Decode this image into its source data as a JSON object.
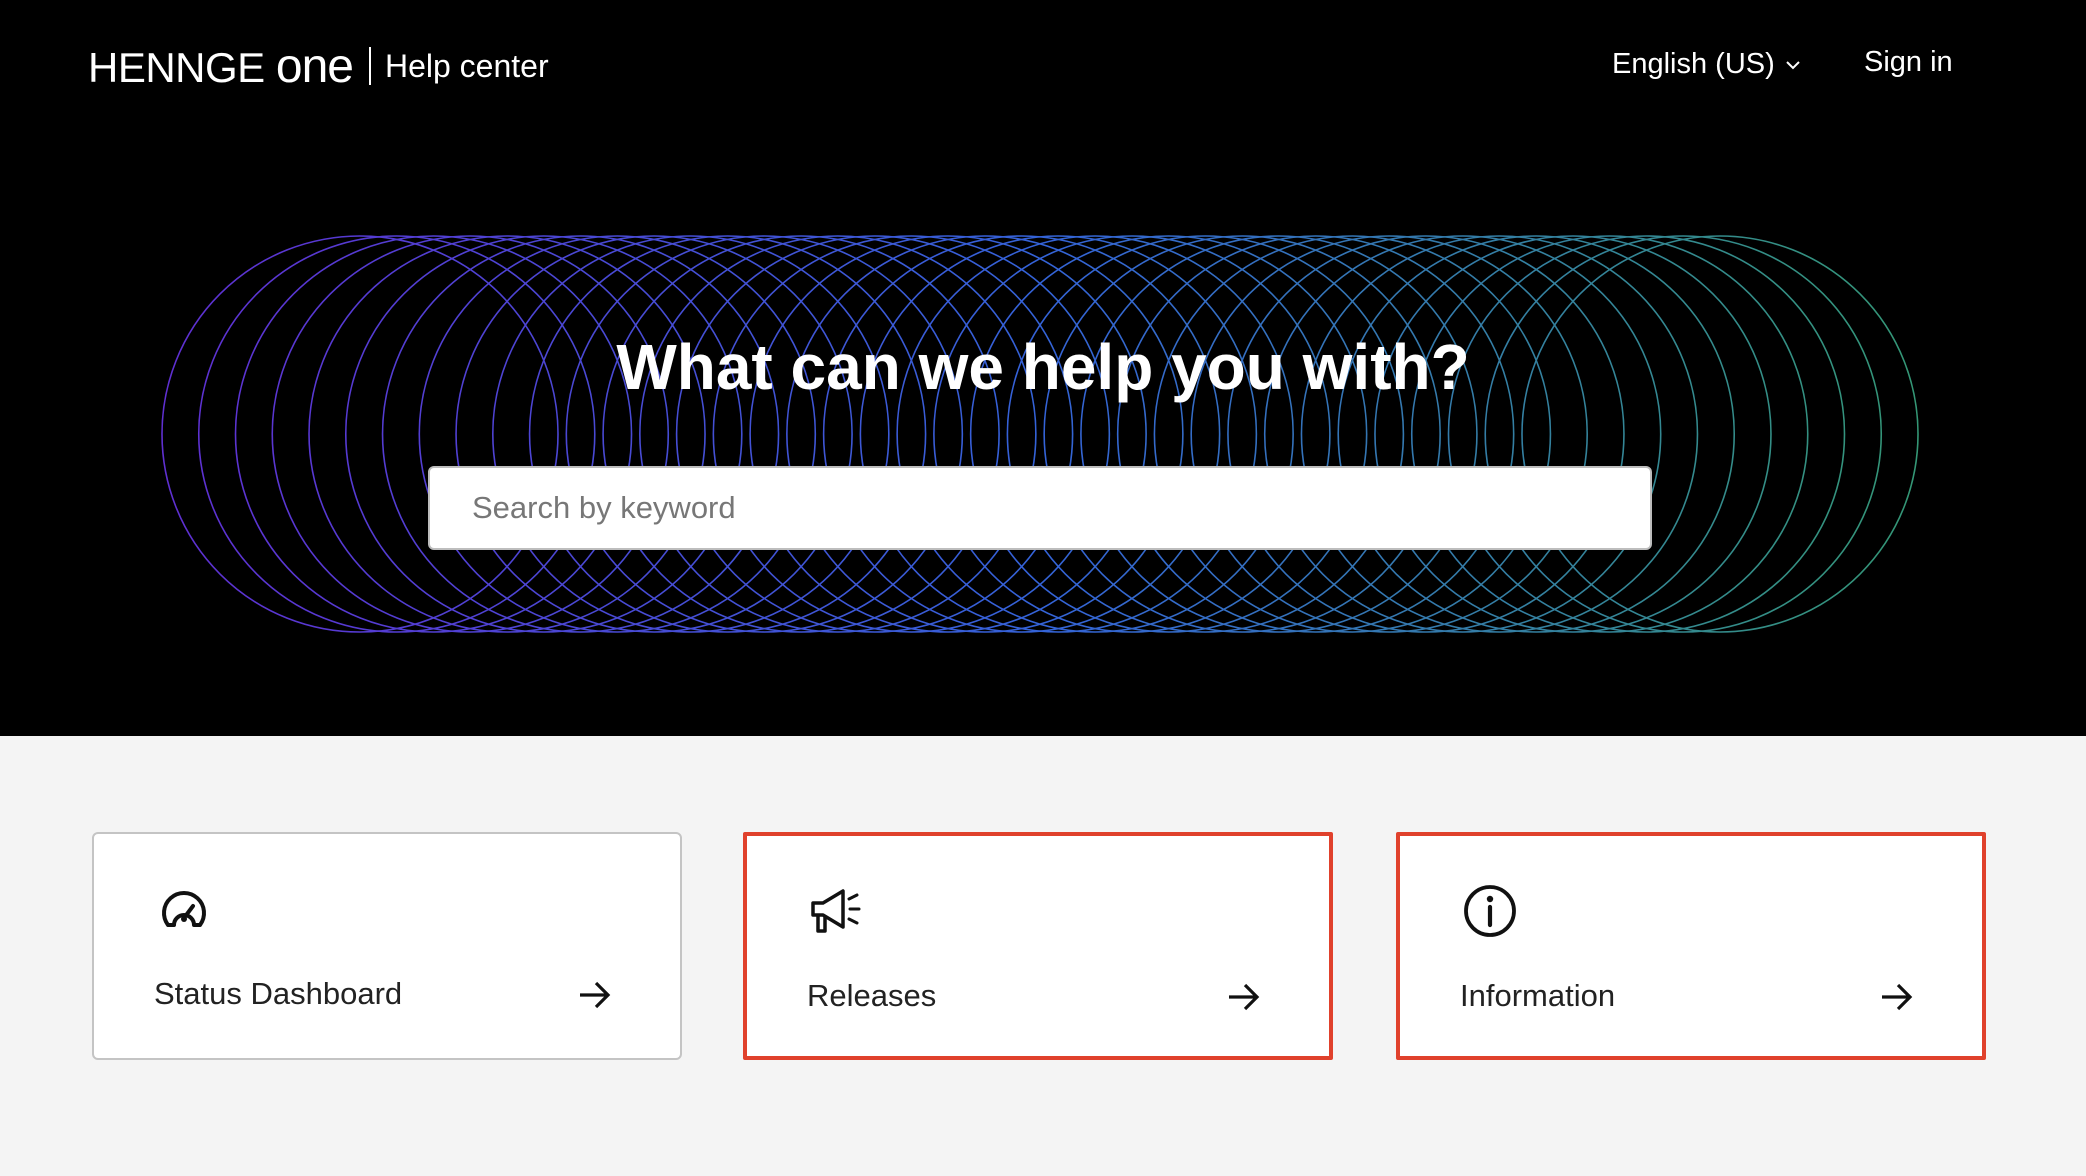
{
  "header": {
    "logo_text": "HENNGE one",
    "brand_subtitle": "Help center",
    "language_label": "English (US)",
    "signin_label": "Sign in"
  },
  "hero": {
    "title": "What can we help you with?",
    "search_placeholder": "Search by keyword"
  },
  "cards": [
    {
      "label": "Status Dashboard",
      "icon": "speedometer-icon",
      "highlighted": false
    },
    {
      "label": "Releases",
      "icon": "megaphone-icon",
      "highlighted": true
    },
    {
      "label": "Information",
      "icon": "info-icon",
      "highlighted": true
    }
  ],
  "colors": {
    "hero_bg": "#000000",
    "page_bg": "#f4f4f4",
    "highlight_border": "#e0412c",
    "ring_start": "#6a35e8",
    "ring_mid": "#3a6ef0",
    "ring_end": "#3aa882"
  }
}
